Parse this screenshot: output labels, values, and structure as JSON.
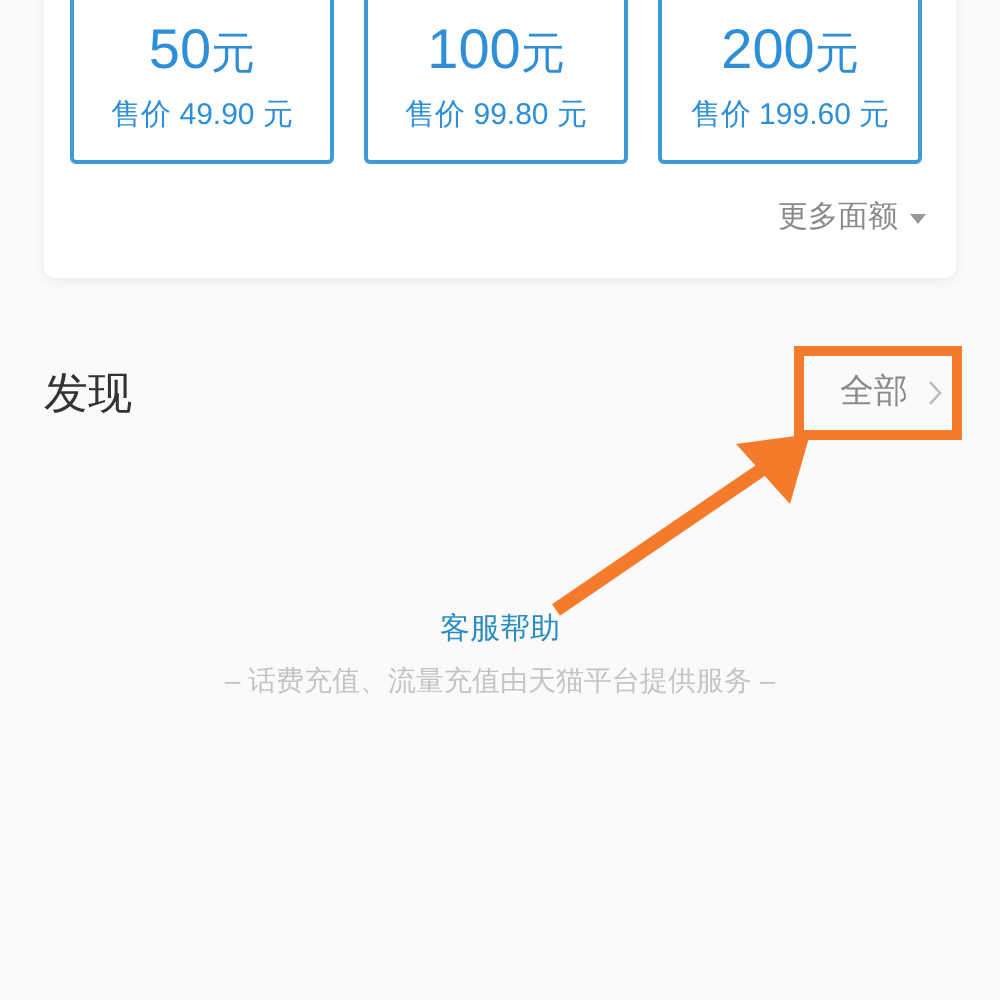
{
  "denominations": [
    {
      "value": "50",
      "unit": "元",
      "price": "售价 49.90 元"
    },
    {
      "value": "100",
      "unit": "元",
      "price": "售价 99.80 元"
    },
    {
      "value": "200",
      "unit": "元",
      "price": "售价 199.60 元"
    }
  ],
  "more_link": "更多面额",
  "discover": {
    "title": "发现",
    "all_link": "全部",
    "highlighted": true
  },
  "help_link": "客服帮助",
  "footer": "– 话费充值、流量充值由天猫平台提供服务 –"
}
